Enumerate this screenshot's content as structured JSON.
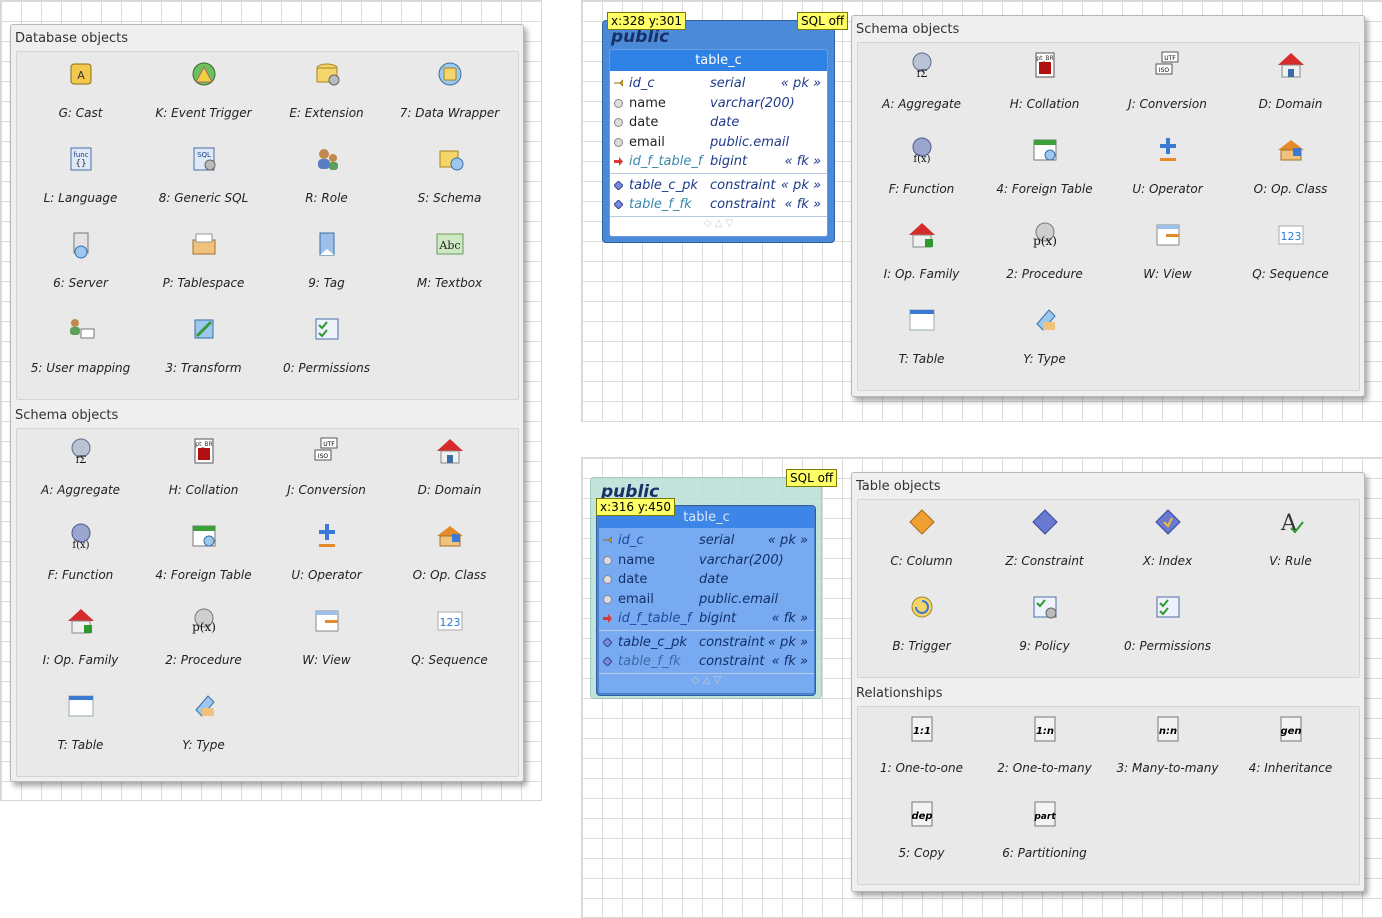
{
  "left_popup": {
    "group1_title": "Database objects",
    "group1_items": [
      "G: Cast",
      "K: Event Trigger",
      "E: Extension",
      "7: Data Wrapper",
      "L: Language",
      "8: Generic SQL",
      "R: Role",
      "S: Schema",
      "6: Server",
      "P: Tablespace",
      "9: Tag",
      "M: Textbox",
      "5: User mapping",
      "3: Transform",
      "0: Permissions"
    ],
    "group2_title": "Schema objects",
    "group2_items": [
      "A: Aggregate",
      "H: Collation",
      "J: Conversion",
      "D: Domain",
      "F: Function",
      "4: Foreign Table",
      "U: Operator",
      "O: Op. Class",
      "I: Op. Family",
      "2: Procedure",
      "W: View",
      "Q: Sequence",
      "T: Table",
      "Y: Type"
    ]
  },
  "right_top_popup": {
    "title": "Schema objects",
    "items": [
      "A: Aggregate",
      "H: Collation",
      "J: Conversion",
      "D: Domain",
      "F: Function",
      "4: Foreign Table",
      "U: Operator",
      "O: Op. Class",
      "I: Op. Family",
      "2: Procedure",
      "W: View",
      "Q: Sequence",
      "T: Table",
      "Y: Type"
    ]
  },
  "right_bottom_popup": {
    "group1_title": "Table objects",
    "group1_items": [
      "C: Column",
      "Z: Constraint",
      "X: Index",
      "V: Rule",
      "B: Trigger",
      "9: Policy",
      "0: Permissions"
    ],
    "group2_title": "Relationships",
    "group2_items": [
      "1: One-to-one",
      "2: One-to-many",
      "3: Many-to-many",
      "4: Inheritance",
      "5: Copy",
      "6: Partitioning"
    ]
  },
  "table_top": {
    "schema": "public",
    "name": "table_c",
    "coords": "x:328 y:301",
    "sql": "SQL off",
    "columns": [
      {
        "name": "id_c",
        "type": "serial",
        "key": "« pk »"
      },
      {
        "name": "name",
        "type": "varchar(200)",
        "key": ""
      },
      {
        "name": "date",
        "type": "date",
        "key": ""
      },
      {
        "name": "email",
        "type": "public.email",
        "key": ""
      },
      {
        "name": "id_f_table_f",
        "type": "bigint",
        "key": "« fk »"
      }
    ],
    "constraints": [
      {
        "name": "table_c_pk",
        "type": "constraint",
        "key": "« pk »"
      },
      {
        "name": "table_f_fk",
        "type": "constraint",
        "key": "« fk »"
      }
    ]
  },
  "table_bottom": {
    "schema": "public",
    "name": "table_c",
    "coords": "x:316 y:450",
    "sql": "SQL off",
    "columns": [
      {
        "name": "id_c",
        "type": "serial",
        "key": "« pk »"
      },
      {
        "name": "name",
        "type": "varchar(200)",
        "key": ""
      },
      {
        "name": "date",
        "type": "date",
        "key": ""
      },
      {
        "name": "email",
        "type": "public.email",
        "key": ""
      },
      {
        "name": "id_f_table_f",
        "type": "bigint",
        "key": "« fk »"
      }
    ],
    "constraints": [
      {
        "name": "table_c_pk",
        "type": "constraint",
        "key": "« pk »"
      },
      {
        "name": "table_f_fk",
        "type": "constraint",
        "key": "« fk »"
      }
    ]
  }
}
